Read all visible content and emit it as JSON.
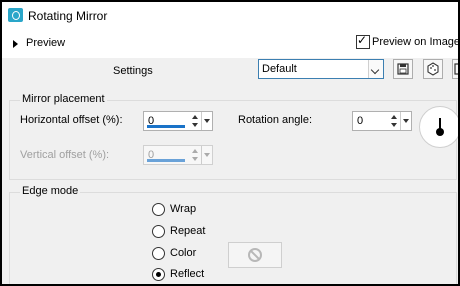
{
  "window": {
    "title": "Rotating Mirror"
  },
  "top": {
    "preview_label": "Preview",
    "preview_on_image_label": "Preview on Image",
    "preview_on_image_checked": true
  },
  "settings": {
    "label": "Settings",
    "preset_value": "Default",
    "toolbar_icons": [
      "save-icon",
      "randomize-icon",
      "reset-icon"
    ]
  },
  "mirror_placement": {
    "title": "Mirror placement",
    "horizontal_label": "Horizontal offset (%):",
    "horizontal_value": "0",
    "vertical_label": "Vertical offset (%):",
    "vertical_value": "0",
    "rotation_label": "Rotation angle:",
    "rotation_value": "0"
  },
  "edge_mode": {
    "title": "Edge mode",
    "options": [
      "Wrap",
      "Repeat",
      "Color",
      "Reflect"
    ],
    "selected": "Reflect"
  }
}
